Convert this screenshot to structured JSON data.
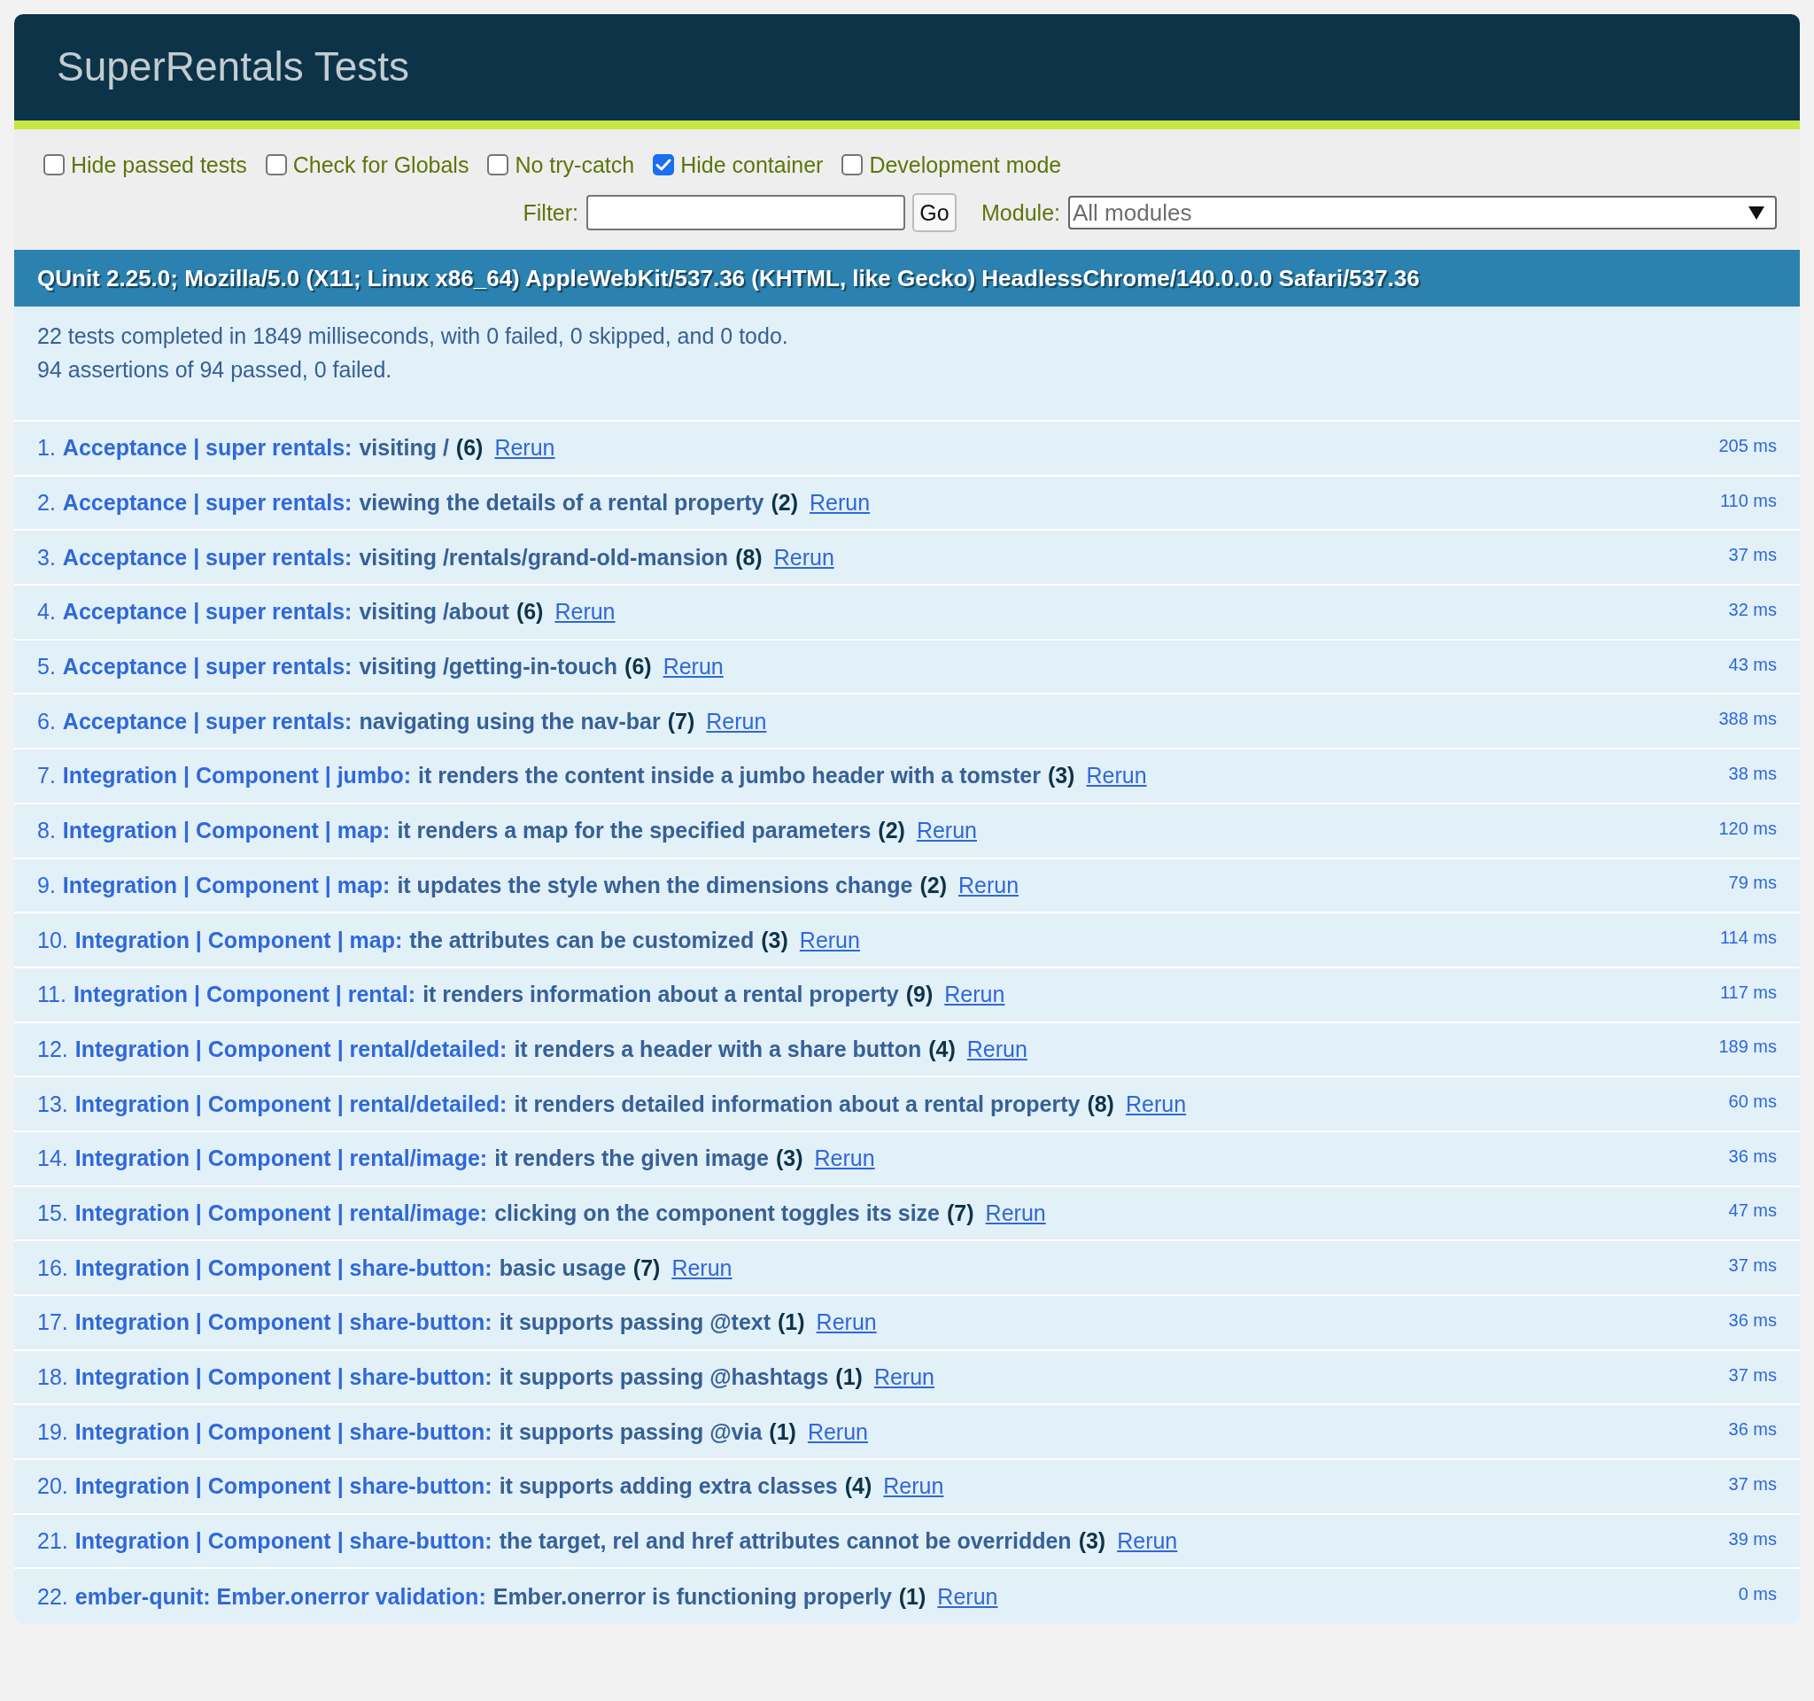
{
  "header": {
    "title": "SuperRentals Tests",
    "passed": true
  },
  "toolbar": {
    "options": [
      {
        "label": "Hide passed tests",
        "checked": false
      },
      {
        "label": "Check for Globals",
        "checked": false
      },
      {
        "label": "No try-catch",
        "checked": false
      },
      {
        "label": "Hide container",
        "checked": true
      },
      {
        "label": "Development mode",
        "checked": false
      }
    ],
    "filter": {
      "label": "Filter:",
      "button": "Go"
    },
    "module_filter": {
      "label": "Module:",
      "value": "All modules"
    }
  },
  "user_agent": "QUnit 2.25.0; Mozilla/5.0 (X11; Linux x86_64) AppleWebKit/537.36 (KHTML, like Gecko) HeadlessChrome/140.0.0.0 Safari/537.36",
  "summary": {
    "lines": [
      "22 tests completed in 1849 milliseconds, with 0 failed, 0 skipped, and 0 todo.",
      "94 assertions of 94 passed, 0 failed."
    ]
  },
  "tests": [
    {
      "number": "1.",
      "module": "Acceptance | super rentals:",
      "name": "visiting /",
      "count": "(6)",
      "link": "Rerun",
      "runtime": "205 ms",
      "passed": true
    },
    {
      "number": "2.",
      "module": "Acceptance | super rentals:",
      "name": "viewing the details of a rental property",
      "count": "(2)",
      "link": "Rerun",
      "runtime": "110 ms",
      "passed": true
    },
    {
      "number": "3.",
      "module": "Acceptance | super rentals:",
      "name": "visiting /rentals/grand-old-mansion",
      "count": "(8)",
      "link": "Rerun",
      "runtime": "37 ms",
      "passed": true
    },
    {
      "number": "4.",
      "module": "Acceptance | super rentals:",
      "name": "visiting /about",
      "count": "(6)",
      "link": "Rerun",
      "runtime": "32 ms",
      "passed": true
    },
    {
      "number": "5.",
      "module": "Acceptance | super rentals:",
      "name": "visiting /getting-in-touch",
      "count": "(6)",
      "link": "Rerun",
      "runtime": "43 ms",
      "passed": true
    },
    {
      "number": "6.",
      "module": "Acceptance | super rentals:",
      "name": "navigating using the nav-bar",
      "count": "(7)",
      "link": "Rerun",
      "runtime": "388 ms",
      "passed": true
    },
    {
      "number": "7.",
      "module": "Integration | Component | jumbo:",
      "name": "it renders the content inside a jumbo header with a tomster",
      "count": "(3)",
      "link": "Rerun",
      "runtime": "38 ms",
      "passed": true
    },
    {
      "number": "8.",
      "module": "Integration | Component | map:",
      "name": "it renders a map for the specified parameters",
      "count": "(2)",
      "link": "Rerun",
      "runtime": "120 ms",
      "passed": true
    },
    {
      "number": "9.",
      "module": "Integration | Component | map:",
      "name": "it updates the style when the dimensions change",
      "count": "(2)",
      "link": "Rerun",
      "runtime": "79 ms",
      "passed": true
    },
    {
      "number": "10.",
      "module": "Integration | Component | map:",
      "name": "the attributes can be customized",
      "count": "(3)",
      "link": "Rerun",
      "runtime": "114 ms",
      "passed": true
    },
    {
      "number": "11.",
      "module": "Integration | Component | rental:",
      "name": "it renders information about a rental property",
      "count": "(9)",
      "link": "Rerun",
      "runtime": "117 ms",
      "passed": true
    },
    {
      "number": "12.",
      "module": "Integration | Component | rental/detailed:",
      "name": "it renders a header with a share button",
      "count": "(4)",
      "link": "Rerun",
      "runtime": "189 ms",
      "passed": true
    },
    {
      "number": "13.",
      "module": "Integration | Component | rental/detailed:",
      "name": "it renders detailed information about a rental property",
      "count": "(8)",
      "link": "Rerun",
      "runtime": "60 ms",
      "passed": true
    },
    {
      "number": "14.",
      "module": "Integration | Component | rental/image:",
      "name": "it renders the given image",
      "count": "(3)",
      "link": "Rerun",
      "runtime": "36 ms",
      "passed": true
    },
    {
      "number": "15.",
      "module": "Integration | Component | rental/image:",
      "name": "clicking on the component toggles its size",
      "count": "(7)",
      "link": "Rerun",
      "runtime": "47 ms",
      "passed": true
    },
    {
      "number": "16.",
      "module": "Integration | Component | share-button:",
      "name": "basic usage",
      "count": "(7)",
      "link": "Rerun",
      "runtime": "37 ms",
      "passed": true
    },
    {
      "number": "17.",
      "module": "Integration | Component | share-button:",
      "name": "it supports passing @text",
      "count": "(1)",
      "link": "Rerun",
      "runtime": "36 ms",
      "passed": true
    },
    {
      "number": "18.",
      "module": "Integration | Component | share-button:",
      "name": "it supports passing @hashtags",
      "count": "(1)",
      "link": "Rerun",
      "runtime": "37 ms",
      "passed": true
    },
    {
      "number": "19.",
      "module": "Integration | Component | share-button:",
      "name": "it supports passing @via",
      "count": "(1)",
      "link": "Rerun",
      "runtime": "36 ms",
      "passed": true
    },
    {
      "number": "20.",
      "module": "Integration | Component | share-button:",
      "name": "it supports adding extra classes",
      "count": "(4)",
      "link": "Rerun",
      "runtime": "37 ms",
      "passed": true
    },
    {
      "number": "21.",
      "module": "Integration | Component | share-button:",
      "name": "the target, rel and href attributes cannot be overridden",
      "count": "(3)",
      "link": "Rerun",
      "runtime": "39 ms",
      "passed": true
    },
    {
      "number": "22.",
      "module": "ember-qunit: Ember.onerror validation:",
      "name": "Ember.onerror is functioning properly",
      "count": "(1)",
      "link": "Rerun",
      "runtime": "0 ms",
      "passed": true
    }
  ]
}
